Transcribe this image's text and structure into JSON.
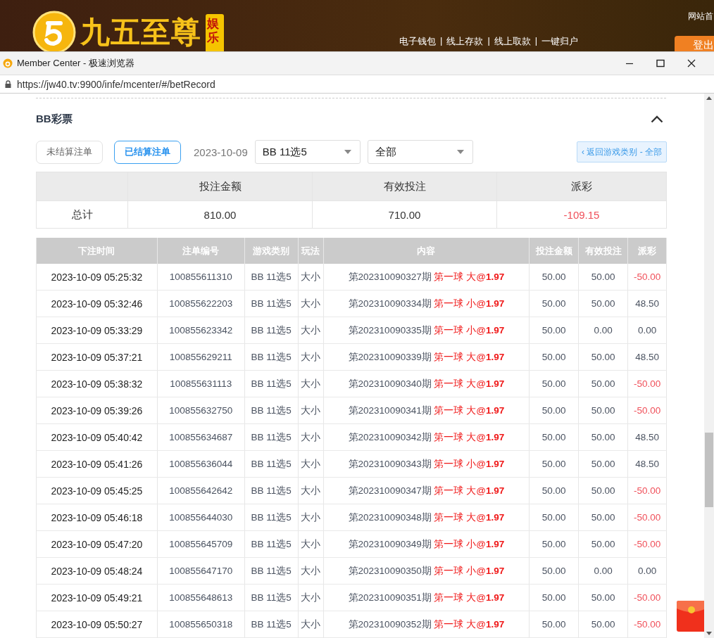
{
  "site_header": {
    "logo_text": "九五至尊",
    "logo_badge": "娱乐",
    "nav_links": [
      "电子钱包",
      "线上存款",
      "线上取款",
      "一键归户"
    ],
    "nav_separator": "|",
    "top_right_link": "网站首",
    "logout_button": "登出"
  },
  "window": {
    "title": "Member Center - 极速浏览器",
    "url": "https://jw40.tv:9900/infe/mcenter/#/betRecord"
  },
  "section": {
    "title": "BB彩票",
    "expanded": true
  },
  "filters": {
    "tabs": [
      {
        "label": "未结算注单",
        "selected": false
      },
      {
        "label": "已结算注单",
        "selected": true
      }
    ],
    "date": "2023-10-09",
    "game_select": "BB 11选5",
    "type_select": "全部",
    "back_button": "‹ 返回游戏类别 - 全部"
  },
  "summary": {
    "columns": [
      "投注金额",
      "有效投注",
      "派彩"
    ],
    "row_label": "总计",
    "values": [
      "810.00",
      "710.00",
      "-109.15"
    ],
    "payout_negative": true
  },
  "table": {
    "columns": [
      "下注时间",
      "注单编号",
      "游戏类别",
      "玩法",
      "内容",
      "投注金额",
      "有效投注",
      "派彩"
    ],
    "rows": [
      {
        "time": "2023-10-09 05:25:32",
        "id": "100855611310",
        "game": "BB 11选5",
        "play": "大小",
        "period": "第202310090327期",
        "pick": "第一球 大@",
        "odds": "1.97",
        "bet": "50.00",
        "valid": "50.00",
        "payout": "-50.00",
        "negative": true
      },
      {
        "time": "2023-10-09 05:32:46",
        "id": "100855622203",
        "game": "BB 11选5",
        "play": "大小",
        "period": "第202310090334期",
        "pick": "第一球 小@",
        "odds": "1.97",
        "bet": "50.00",
        "valid": "50.00",
        "payout": "48.50",
        "negative": false
      },
      {
        "time": "2023-10-09 05:33:29",
        "id": "100855623342",
        "game": "BB 11选5",
        "play": "大小",
        "period": "第202310090335期",
        "pick": "第一球 小@",
        "odds": "1.97",
        "bet": "50.00",
        "valid": "0.00",
        "payout": "0.00",
        "negative": false
      },
      {
        "time": "2023-10-09 05:37:21",
        "id": "100855629211",
        "game": "BB 11选5",
        "play": "大小",
        "period": "第202310090339期",
        "pick": "第一球 大@",
        "odds": "1.97",
        "bet": "50.00",
        "valid": "50.00",
        "payout": "48.50",
        "negative": false
      },
      {
        "time": "2023-10-09 05:38:32",
        "id": "100855631113",
        "game": "BB 11选5",
        "play": "大小",
        "period": "第202310090340期",
        "pick": "第一球 大@",
        "odds": "1.97",
        "bet": "50.00",
        "valid": "50.00",
        "payout": "-50.00",
        "negative": true
      },
      {
        "time": "2023-10-09 05:39:26",
        "id": "100855632750",
        "game": "BB 11选5",
        "play": "大小",
        "period": "第202310090341期",
        "pick": "第一球 大@",
        "odds": "1.97",
        "bet": "50.00",
        "valid": "50.00",
        "payout": "-50.00",
        "negative": true
      },
      {
        "time": "2023-10-09 05:40:42",
        "id": "100855634687",
        "game": "BB 11选5",
        "play": "大小",
        "period": "第202310090342期",
        "pick": "第一球 大@",
        "odds": "1.97",
        "bet": "50.00",
        "valid": "50.00",
        "payout": "48.50",
        "negative": false
      },
      {
        "time": "2023-10-09 05:41:26",
        "id": "100855636044",
        "game": "BB 11选5",
        "play": "大小",
        "period": "第202310090343期",
        "pick": "第一球 小@",
        "odds": "1.97",
        "bet": "50.00",
        "valid": "50.00",
        "payout": "48.50",
        "negative": false
      },
      {
        "time": "2023-10-09 05:45:25",
        "id": "100855642642",
        "game": "BB 11选5",
        "play": "大小",
        "period": "第202310090347期",
        "pick": "第一球 大@",
        "odds": "1.97",
        "bet": "50.00",
        "valid": "50.00",
        "payout": "-50.00",
        "negative": true
      },
      {
        "time": "2023-10-09 05:46:18",
        "id": "100855644030",
        "game": "BB 11选5",
        "play": "大小",
        "period": "第202310090348期",
        "pick": "第一球 大@",
        "odds": "1.97",
        "bet": "50.00",
        "valid": "50.00",
        "payout": "-50.00",
        "negative": true
      },
      {
        "time": "2023-10-09 05:47:20",
        "id": "100855645709",
        "game": "BB 11选5",
        "play": "大小",
        "period": "第202310090349期",
        "pick": "第一球 小@",
        "odds": "1.97",
        "bet": "50.00",
        "valid": "50.00",
        "payout": "-50.00",
        "negative": true
      },
      {
        "time": "2023-10-09 05:48:24",
        "id": "100855647170",
        "game": "BB 11选5",
        "play": "大小",
        "period": "第202310090350期",
        "pick": "第一球 小@",
        "odds": "1.97",
        "bet": "50.00",
        "valid": "0.00",
        "payout": "0.00",
        "negative": false
      },
      {
        "time": "2023-10-09 05:49:21",
        "id": "100855648613",
        "game": "BB 11选5",
        "play": "大小",
        "period": "第202310090351期",
        "pick": "第一球 大@",
        "odds": "1.97",
        "bet": "50.00",
        "valid": "50.00",
        "payout": "-50.00",
        "negative": true
      },
      {
        "time": "2023-10-09 05:50:27",
        "id": "100855650318",
        "game": "BB 11选5",
        "play": "大小",
        "period": "第202310090352期",
        "pick": "第一球 大@",
        "odds": "1.97",
        "bet": "50.00",
        "valid": "50.00",
        "payout": "-50.00",
        "negative": true
      }
    ]
  }
}
